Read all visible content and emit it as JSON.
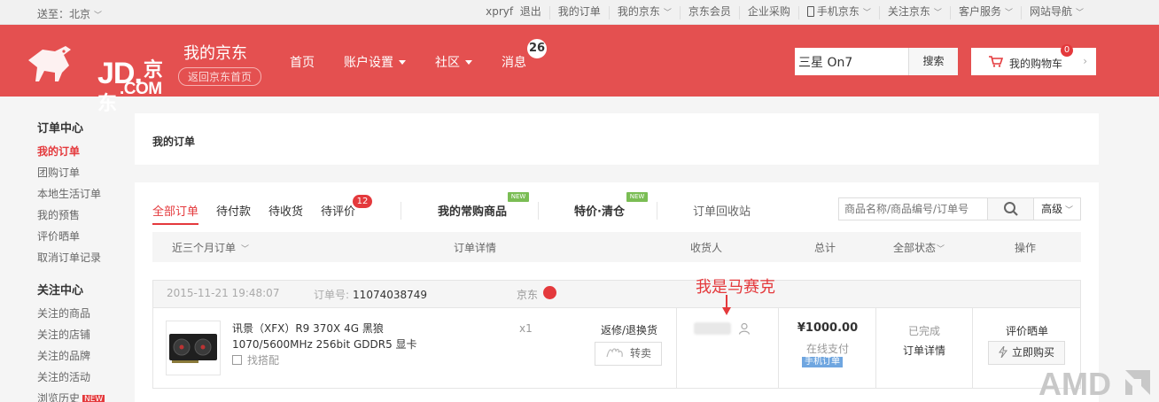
{
  "topbar": {
    "location": "送至：北京",
    "links": [
      {
        "user": "xpryf",
        "text": "退出"
      },
      {
        "text": "我的订单"
      },
      {
        "text": "我的京东",
        "dropdown": true
      },
      {
        "text": "京东会员"
      },
      {
        "text": "企业采购"
      },
      {
        "text": "手机京东",
        "dropdown": true,
        "icon": "phone-icon"
      },
      {
        "text": "关注京东",
        "dropdown": true
      },
      {
        "text": "客户服务",
        "dropdown": true
      },
      {
        "text": "网站导航",
        "dropdown": true
      }
    ]
  },
  "header": {
    "logo_main": "JD.",
    "logo_cn": "京东",
    "logo_sub": ".COM",
    "title": "我的京东",
    "home_link": "返回京东首页",
    "nav": [
      {
        "label": "首页"
      },
      {
        "label": "账户设置",
        "dropdown": true
      },
      {
        "label": "社区",
        "dropdown": true
      },
      {
        "label": "消息",
        "badge": "26"
      }
    ],
    "search_value": "三星 On7",
    "search_button": "搜索",
    "cart_label": "我的购物车",
    "cart_count": "0",
    "colors": {
      "brand": "#e45050",
      "accent": "#e4393c"
    }
  },
  "sidebar": {
    "group1_title": "订单中心",
    "group1": [
      "我的订单",
      "团购订单",
      "本地生活订单",
      "我的预售",
      "评价晒单",
      "取消订单记录"
    ],
    "group2_title": "关注中心",
    "group2": [
      "关注的商品",
      "关注的店铺",
      "关注的品牌",
      "关注的活动",
      "浏览历史"
    ],
    "new_tag": "NEW"
  },
  "main": {
    "page_title": "我的订单",
    "tabs": [
      "全部订单",
      "待付款",
      "待收货",
      "待评价"
    ],
    "review_badge": "12",
    "frequent": "我的常购商品",
    "clearance": "特价·清仓",
    "new_flag": "NEW",
    "recycle": "订单回收站",
    "order_search_placeholder": "商品名称/商品编号/订单号",
    "advanced": "高级",
    "columns": {
      "period": "近三个月订单",
      "detail": "订单详情",
      "receiver": "收货人",
      "total": "总计",
      "status": "全部状态",
      "ops": "操作"
    }
  },
  "order": {
    "date": "2015-11-21 19:48:07",
    "number_label": "订单号:",
    "number": "11074038749",
    "shop": "京东",
    "product_name": "讯景（XFX）R9 370X 4G 黑狼 1070/5600MHz 256bit GDDR5 显卡",
    "match": "找搭配",
    "qty": "x1",
    "return_label": "返修/退换货",
    "sell_label": "转卖",
    "amount": "¥1000.00",
    "pay_method": "在线支付",
    "mobile_tag": "手机订单",
    "status": "已完成",
    "status_detail": "订单详情",
    "review": "评价晒单",
    "buy_again": "立即购买"
  },
  "annotation": {
    "text": "我是马赛克"
  },
  "watermark": {
    "text": "AMD"
  }
}
